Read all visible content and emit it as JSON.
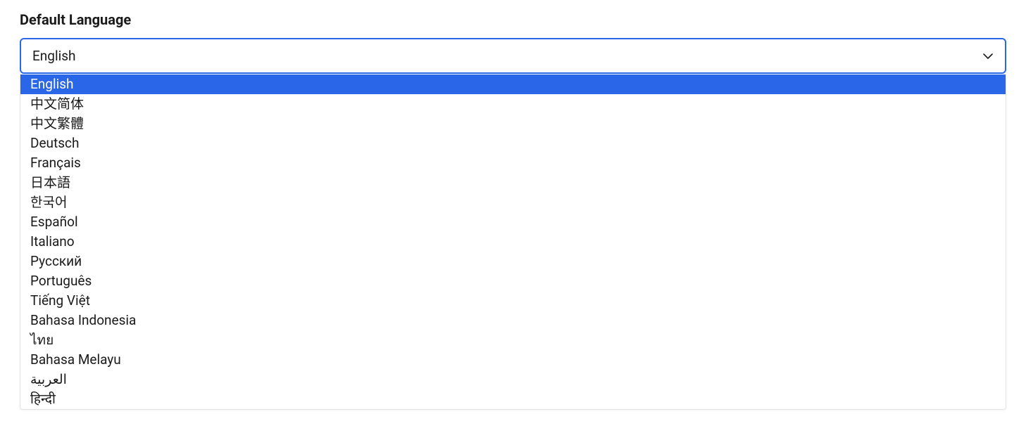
{
  "label": "Default Language",
  "selected": "English",
  "highlighted_index": 0,
  "options": [
    "English",
    "中文简体",
    "中文繁體",
    "Deutsch",
    "Français",
    "日本語",
    "한국어",
    "Español",
    "Italiano",
    "Русский",
    "Português",
    "Tiếng Việt",
    "Bahasa Indonesia",
    "ไทย",
    "Bahasa Melayu",
    "العربية",
    "हिन्दी"
  ]
}
